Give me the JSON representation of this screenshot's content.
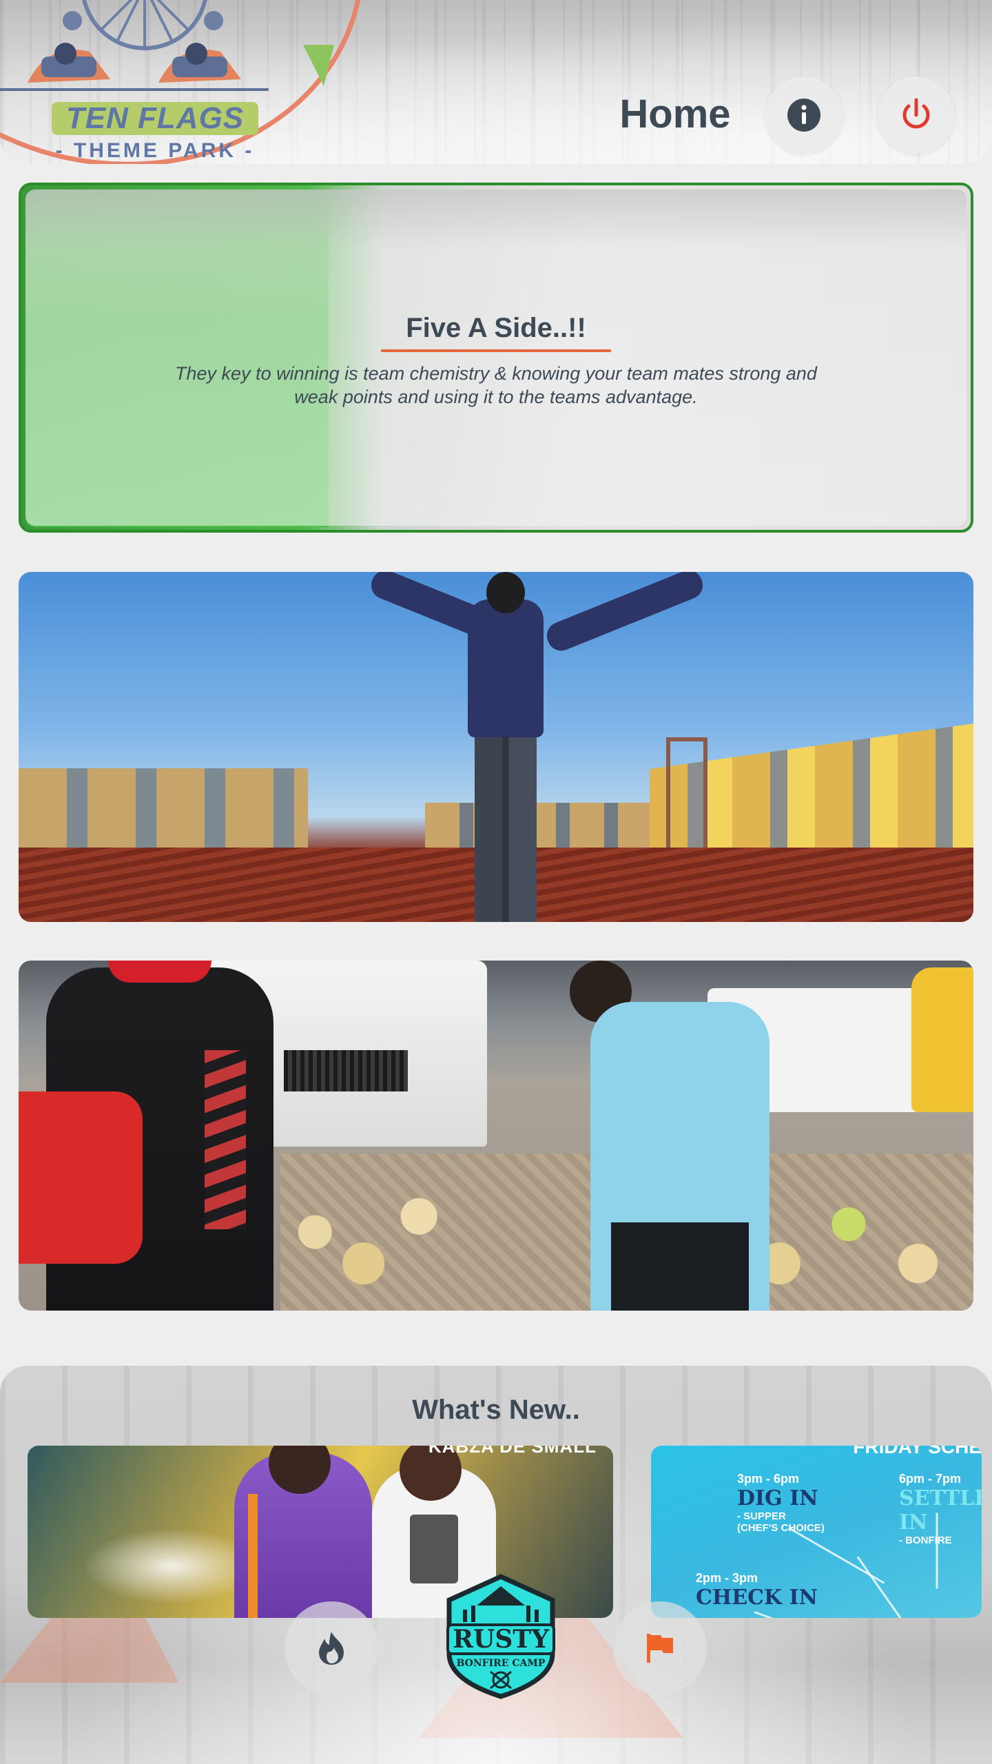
{
  "header": {
    "logo": {
      "title": "TEN FLAGS",
      "subtitle": "- THEME PARK -"
    },
    "page_title": "Home",
    "buttons": {
      "info_icon": "info-icon",
      "power_icon": "power-icon"
    }
  },
  "cards": [
    {
      "title": "Five A Side..!!",
      "description": "They key to winning is team chemistry & knowing your team mates strong and weak points and using it to the teams advantage."
    },
    {
      "image": "celebrating-man-photo"
    },
    {
      "image": "food-distribution-photo"
    }
  ],
  "whats_new": {
    "title": "What's New..",
    "promos": [
      {
        "caption": "KABZA DE SMALL"
      },
      {
        "heading": "FRIDAY SCHE",
        "slots": [
          {
            "time": "3pm - 6pm",
            "activity": "DIG IN",
            "note1": "- SUPPER",
            "note2": "(CHEF'S CHOICE)"
          },
          {
            "time": "6pm - 7pm",
            "activity": "SETTLE IN",
            "note1": "- BONFIRE",
            "note2": ""
          },
          {
            "time": "2pm - 3pm",
            "activity": "CHECK IN",
            "note1": "",
            "note2": ""
          }
        ]
      }
    ]
  },
  "bottom_nav": {
    "left_icon": "fire-icon",
    "center_logo": {
      "line1": "RUSTY",
      "line2": "BONFIRE CAMP"
    },
    "right_icon": "flag-icon"
  },
  "colors": {
    "accent": "#e6673a",
    "text": "#3d4a56",
    "power": "#e23a2e",
    "badge": "#2de0dc"
  }
}
